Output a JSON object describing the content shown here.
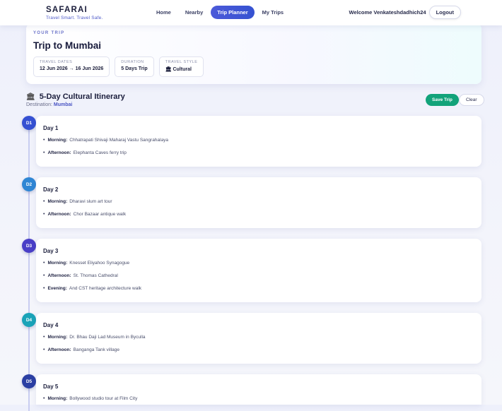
{
  "brand": {
    "name": "SAFARAI",
    "tagline": "Travel Smart. Travel Safe."
  },
  "nav": [
    {
      "label": "Home",
      "active": false
    },
    {
      "label": "Nearby",
      "active": false
    },
    {
      "label": "Trip Planner",
      "active": true
    },
    {
      "label": "My Trips",
      "active": false
    }
  ],
  "user": {
    "welcome": "Welcome Venkateshdadhich24",
    "logout": "Logout"
  },
  "trip": {
    "eyebrow": "YOUR TRIP",
    "title": "Trip to Mumbai",
    "chips": [
      {
        "label": "TRAVEL DATES",
        "value": "12 Jun 2026 → 16 Jun 2026"
      },
      {
        "label": "DURATION",
        "value": "5 Days Trip"
      },
      {
        "label": "TRAVEL STYLE",
        "value": "🏛 Cultural"
      }
    ]
  },
  "itinerary": {
    "title": "5-Day Cultural Itinerary",
    "destination_label": "Destination:",
    "destination": "Mumbai",
    "save": "Save Trip",
    "clear": "Clear"
  },
  "days": [
    {
      "badge": "D1",
      "title": "Day 1",
      "activities": [
        {
          "period": "Morning:",
          "text": "Chhatrapati Shivaji Maharaj Vastu Sangrahalaya"
        },
        {
          "period": "Afternoon:",
          "text": "Elephanta Caves ferry trip"
        }
      ]
    },
    {
      "badge": "D2",
      "title": "Day 2",
      "activities": [
        {
          "period": "Morning:",
          "text": "Dharavi slum art tour"
        },
        {
          "period": "Afternoon:",
          "text": "Chor Bazaar antique walk"
        }
      ]
    },
    {
      "badge": "D3",
      "title": "Day 3",
      "activities": [
        {
          "period": "Morning:",
          "text": "Knesset Eliyahoo Synagogue"
        },
        {
          "period": "Afternoon:",
          "text": "St. Thomas Cathedral"
        },
        {
          "period": "Evening:",
          "text": "And CST heritage architecture walk"
        }
      ]
    },
    {
      "badge": "D4",
      "title": "Day 4",
      "activities": [
        {
          "period": "Morning:",
          "text": "Dr. Bhau Daji Lad Museum in Byculla"
        },
        {
          "period": "Afternoon:",
          "text": "Banganga Tank village"
        }
      ]
    },
    {
      "badge": "D5",
      "title": "Day 5",
      "activities": [
        {
          "period": "Morning:",
          "text": "Bollywood studio tour at Film City"
        }
      ]
    }
  ],
  "colors": {
    "accent": "#3f51d6",
    "save": "#12a37a",
    "badges": [
      "#3550d2",
      "#2f86d4",
      "#4a3fc7",
      "#1aa3b8",
      "#2b3fa3"
    ]
  }
}
